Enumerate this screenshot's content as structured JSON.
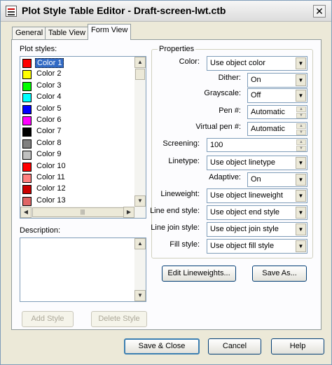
{
  "window": {
    "title": "Plot Style Table Editor - Draft-screen-lwt.ctb",
    "close_glyph": "✕"
  },
  "tabs": [
    {
      "label": "General"
    },
    {
      "label": "Table View"
    },
    {
      "label": "Form View"
    }
  ],
  "plot_styles": {
    "label": "Plot styles:",
    "selected": "Color 1",
    "items": [
      {
        "label": "Color 1",
        "color": "#ff0000"
      },
      {
        "label": "Color 2",
        "color": "#ffff00"
      },
      {
        "label": "Color 3",
        "color": "#00ff00"
      },
      {
        "label": "Color 4",
        "color": "#00ffff"
      },
      {
        "label": "Color 5",
        "color": "#0000ff"
      },
      {
        "label": "Color 6",
        "color": "#ff00ff"
      },
      {
        "label": "Color 7",
        "color": "#000000"
      },
      {
        "label": "Color 8",
        "color": "#808080"
      },
      {
        "label": "Color 9",
        "color": "#c0c0c0"
      },
      {
        "label": "Color 10",
        "color": "#ff0000"
      },
      {
        "label": "Color 11",
        "color": "#ff7f7f"
      },
      {
        "label": "Color 12",
        "color": "#cc0000"
      },
      {
        "label": "Color 13",
        "color": "#e06666"
      }
    ]
  },
  "description": {
    "label": "Description:"
  },
  "buttons": {
    "add_style": "Add Style",
    "delete_style": "Delete Style",
    "edit_lineweights": "Edit Lineweights...",
    "save_as": "Save As...",
    "save_close": "Save & Close",
    "cancel": "Cancel",
    "help": "Help"
  },
  "properties": {
    "title": "Properties",
    "color": {
      "label": "Color:",
      "value": "Use object color"
    },
    "dither": {
      "label": "Dither:",
      "value": "On"
    },
    "grayscale": {
      "label": "Grayscale:",
      "value": "Off"
    },
    "pen": {
      "label": "Pen #:",
      "value": "Automatic"
    },
    "virtual_pen": {
      "label": "Virtual pen #:",
      "value": "Automatic"
    },
    "screening": {
      "label": "Screening:",
      "value": "100"
    },
    "linetype": {
      "label": "Linetype:",
      "value": "Use object linetype"
    },
    "adaptive": {
      "label": "Adaptive:",
      "value": "On"
    },
    "lineweight": {
      "label": "Lineweight:",
      "value": "Use object lineweight"
    },
    "line_end_style": {
      "label": "Line end style:",
      "value": "Use object end style"
    },
    "line_join_style": {
      "label": "Line join style:",
      "value": "Use object join style"
    },
    "fill_style": {
      "label": "Fill style:",
      "value": "Use object fill style"
    }
  }
}
